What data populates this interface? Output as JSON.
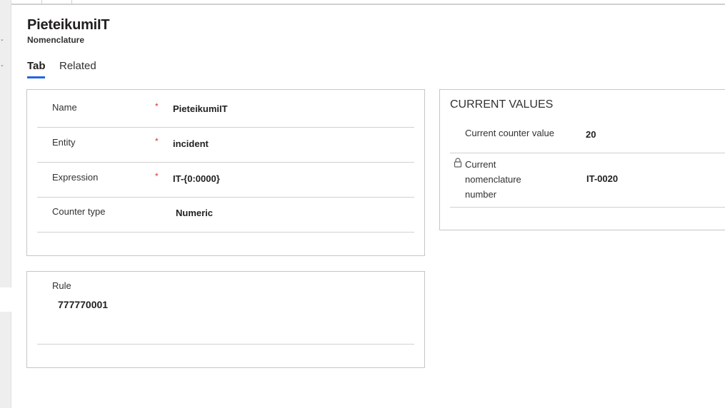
{
  "record": {
    "title": "PieteikumiIT",
    "entity": "Nomenclature"
  },
  "tabs": [
    {
      "label": "Tab",
      "active": true
    },
    {
      "label": "Related",
      "active": false
    }
  ],
  "general": {
    "fields": [
      {
        "label": "Name",
        "required": true,
        "value": "PieteikumiIT"
      },
      {
        "label": "Entity",
        "required": true,
        "value": "incident"
      },
      {
        "label": "Expression",
        "required": true,
        "value": "IT-{0:0000}"
      },
      {
        "label": "Counter type",
        "required": false,
        "value": "Numeric"
      }
    ],
    "required_marker": "*"
  },
  "rule": {
    "label": "Rule",
    "value": "777770001"
  },
  "current_values": {
    "title": "CURRENT VALUES",
    "counter_label": "Current counter value",
    "counter_value": "20",
    "number_label_lines": [
      "Current",
      "nomenclature",
      "number"
    ],
    "number_value": "IT-0020",
    "locked_icon": "lock-icon"
  },
  "colors": {
    "accent": "#2266e3",
    "required": "#d13438",
    "border": "#c8c6c4"
  }
}
